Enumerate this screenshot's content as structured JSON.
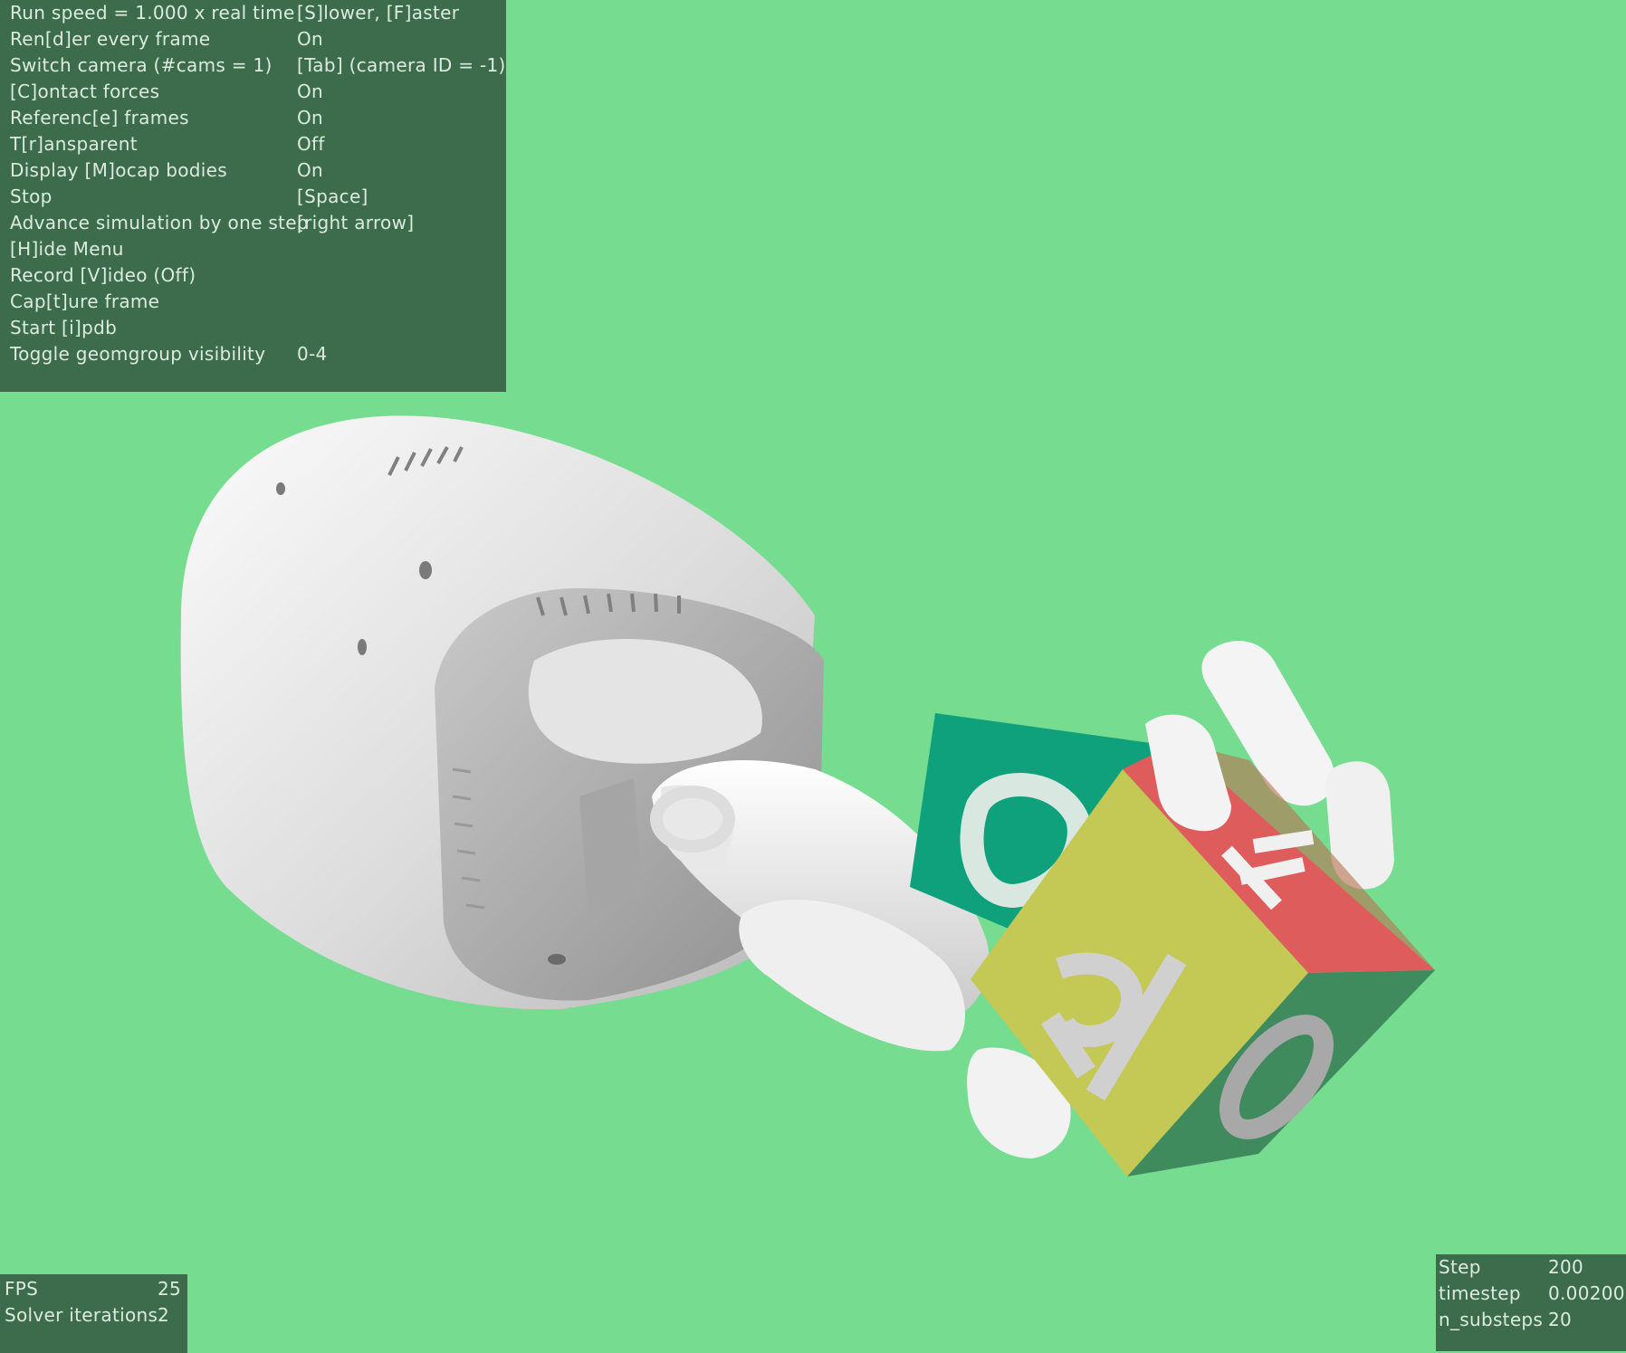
{
  "menu": {
    "rows": [
      {
        "key": "Run speed = 1.000 x real time",
        "value": "[S]lower, [F]aster"
      },
      {
        "key": "Ren[d]er every frame",
        "value": "On"
      },
      {
        "key": "Switch camera (#cams = 1)",
        "value": "[Tab] (camera ID = -1)"
      },
      {
        "key": "[C]ontact forces",
        "value": "On"
      },
      {
        "key": "Referenc[e] frames",
        "value": "On"
      },
      {
        "key": "T[r]ansparent",
        "value": "Off"
      },
      {
        "key": "Display [M]ocap bodies",
        "value": "On"
      },
      {
        "key": "Stop",
        "value": "[Space]"
      },
      {
        "key": "Advance simulation by one step",
        "value": "[right arrow]"
      },
      {
        "key": "[H]ide Menu",
        "value": ""
      },
      {
        "key": "Record [V]ideo (Off)",
        "value": ""
      },
      {
        "key": "Cap[t]ure frame",
        "value": ""
      },
      {
        "key": "Start [i]pdb",
        "value": ""
      },
      {
        "key": "Toggle geomgroup visibility",
        "value": "0-4"
      }
    ]
  },
  "fps_panel": {
    "rows": [
      {
        "key": "FPS",
        "value": "25"
      },
      {
        "key": "Solver iterations",
        "value": "2"
      }
    ]
  },
  "stats_panel": {
    "rows": [
      {
        "key": "Step",
        "value": "200"
      },
      {
        "key": "timestep",
        "value": "0.00200"
      },
      {
        "key": "n_substeps",
        "value": "20"
      }
    ]
  },
  "scene": {
    "cube_letters": {
      "front": "R",
      "top": "E",
      "side": "O",
      "back": "O"
    },
    "colors": {
      "background": "#75dc90",
      "panel": "#3c6c4c",
      "cube_front": "#c3c954",
      "cube_top": "#de5c5c",
      "cube_side": "#3f8b5d",
      "cube_back": "#0fa07c",
      "hand": "#f0f0f0"
    }
  }
}
